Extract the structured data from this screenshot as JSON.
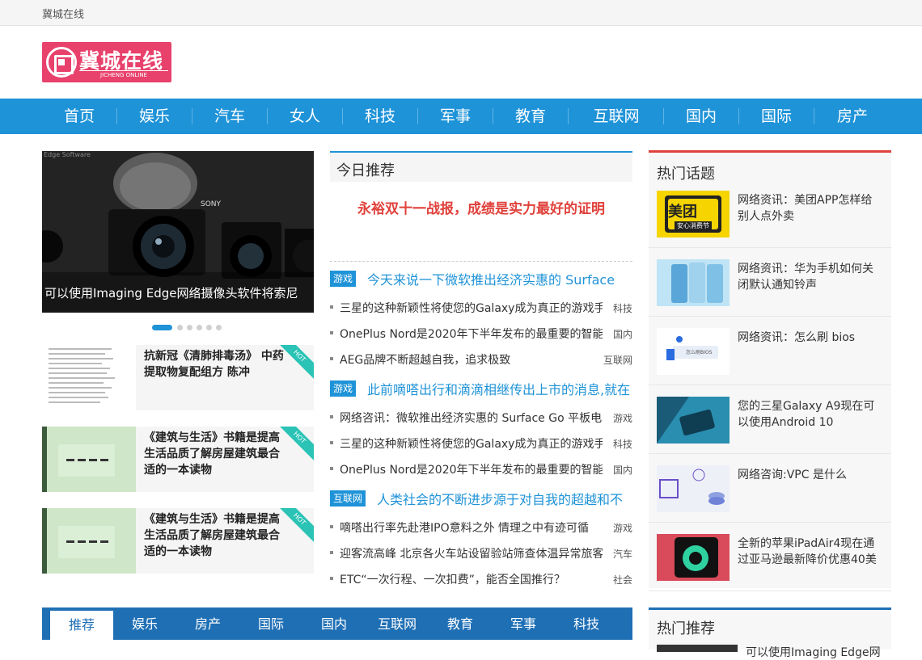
{
  "topbar": {
    "site_name": "冀城在线"
  },
  "logo": {
    "cn": "冀城在线",
    "en": "JICHENG ONLINE"
  },
  "nav": [
    "首页",
    "娱乐",
    "汽车",
    "女人",
    "科技",
    "军事",
    "教育",
    "互联网",
    "国内",
    "国际",
    "房产"
  ],
  "slider": {
    "caption": "可以使用Imaging Edge网络摄像头软件将索尼",
    "watermark": "Edge Software",
    "dots": 6,
    "active": 0
  },
  "cards": [
    {
      "title": "抗新冠《清肺排毒汤》 中药提取物复配组方 陈冲",
      "badge": "HOT"
    },
    {
      "title": "《建筑与生活》书籍是提高生活品质了解房屋建筑最合适的一本读物",
      "badge": "HOT"
    },
    {
      "title": "《建筑与生活》书籍是提高生活品质了解房屋建筑最合适的一本读物",
      "badge": "HOT"
    }
  ],
  "today": {
    "title": "今日推荐",
    "headline": "永裕双十一战报，成绩是实力最好的证明"
  },
  "groups": [
    {
      "tag": "游戏",
      "title": "今天来说一下微软推出经济实惠的 Surface",
      "items": [
        {
          "text": "三星的这种新颖性将使您的Galaxy成为真正的游戏手",
          "cat": "科技"
        },
        {
          "text": "OnePlus Nord是2020年下半年发布的最重要的智能",
          "cat": "国内"
        },
        {
          "text": "AEG品牌不断超越自我，追求极致",
          "cat": "互联网"
        }
      ]
    },
    {
      "tag": "游戏",
      "title": "此前嘀嗒出行和滴滴相继传出上市的消息,就在",
      "items": [
        {
          "text": "网络咨讯：微软推出经济实惠的 Surface Go 平板电",
          "cat": "游戏"
        },
        {
          "text": "三星的这种新颖性将使您的Galaxy成为真正的游戏手",
          "cat": "科技"
        },
        {
          "text": "OnePlus Nord是2020年下半年发布的最重要的智能",
          "cat": "国内"
        }
      ]
    },
    {
      "tag": "互联网",
      "title": "人类社会的不断进步源于对自我的超越和不",
      "items": [
        {
          "text": "嘀嗒出行率先赴港IPO意料之外 情理之中有迹可循",
          "cat": "游戏"
        },
        {
          "text": "迎客流高峰 北京各火车站设留验站筛查体温异常旅客",
          "cat": "汽车"
        },
        {
          "text": "ETC“一次行程、一次扣费”，能否全国推行？",
          "cat": "社会"
        }
      ]
    }
  ],
  "hot_topics": {
    "title": "热门话题",
    "items": [
      {
        "text": "网络资讯：美团APP怎样给别人点外卖",
        "thumb_label": "美团",
        "thumb_sub": "安心消费节"
      },
      {
        "text": "网络资讯：华为手机如何关闭默认通知铃声"
      },
      {
        "text": "网络资讯：怎么刷 bios",
        "thumb_label": "怎么刷BIOS"
      },
      {
        "text": "您的三星Galaxy A9现在可以使用Android 10"
      },
      {
        "text": "网络咨询:VPC 是什么"
      },
      {
        "text": "全新的苹果iPadAir4现在通过亚马逊最新降价优惠40美"
      }
    ]
  },
  "bottom_tabs": [
    "推荐",
    "娱乐",
    "房产",
    "国际",
    "国内",
    "互联网",
    "教育",
    "军事",
    "科技"
  ],
  "hot_recommend": {
    "title": "热门推荐",
    "peek_text": "可以使用Imaging Edge网"
  }
}
